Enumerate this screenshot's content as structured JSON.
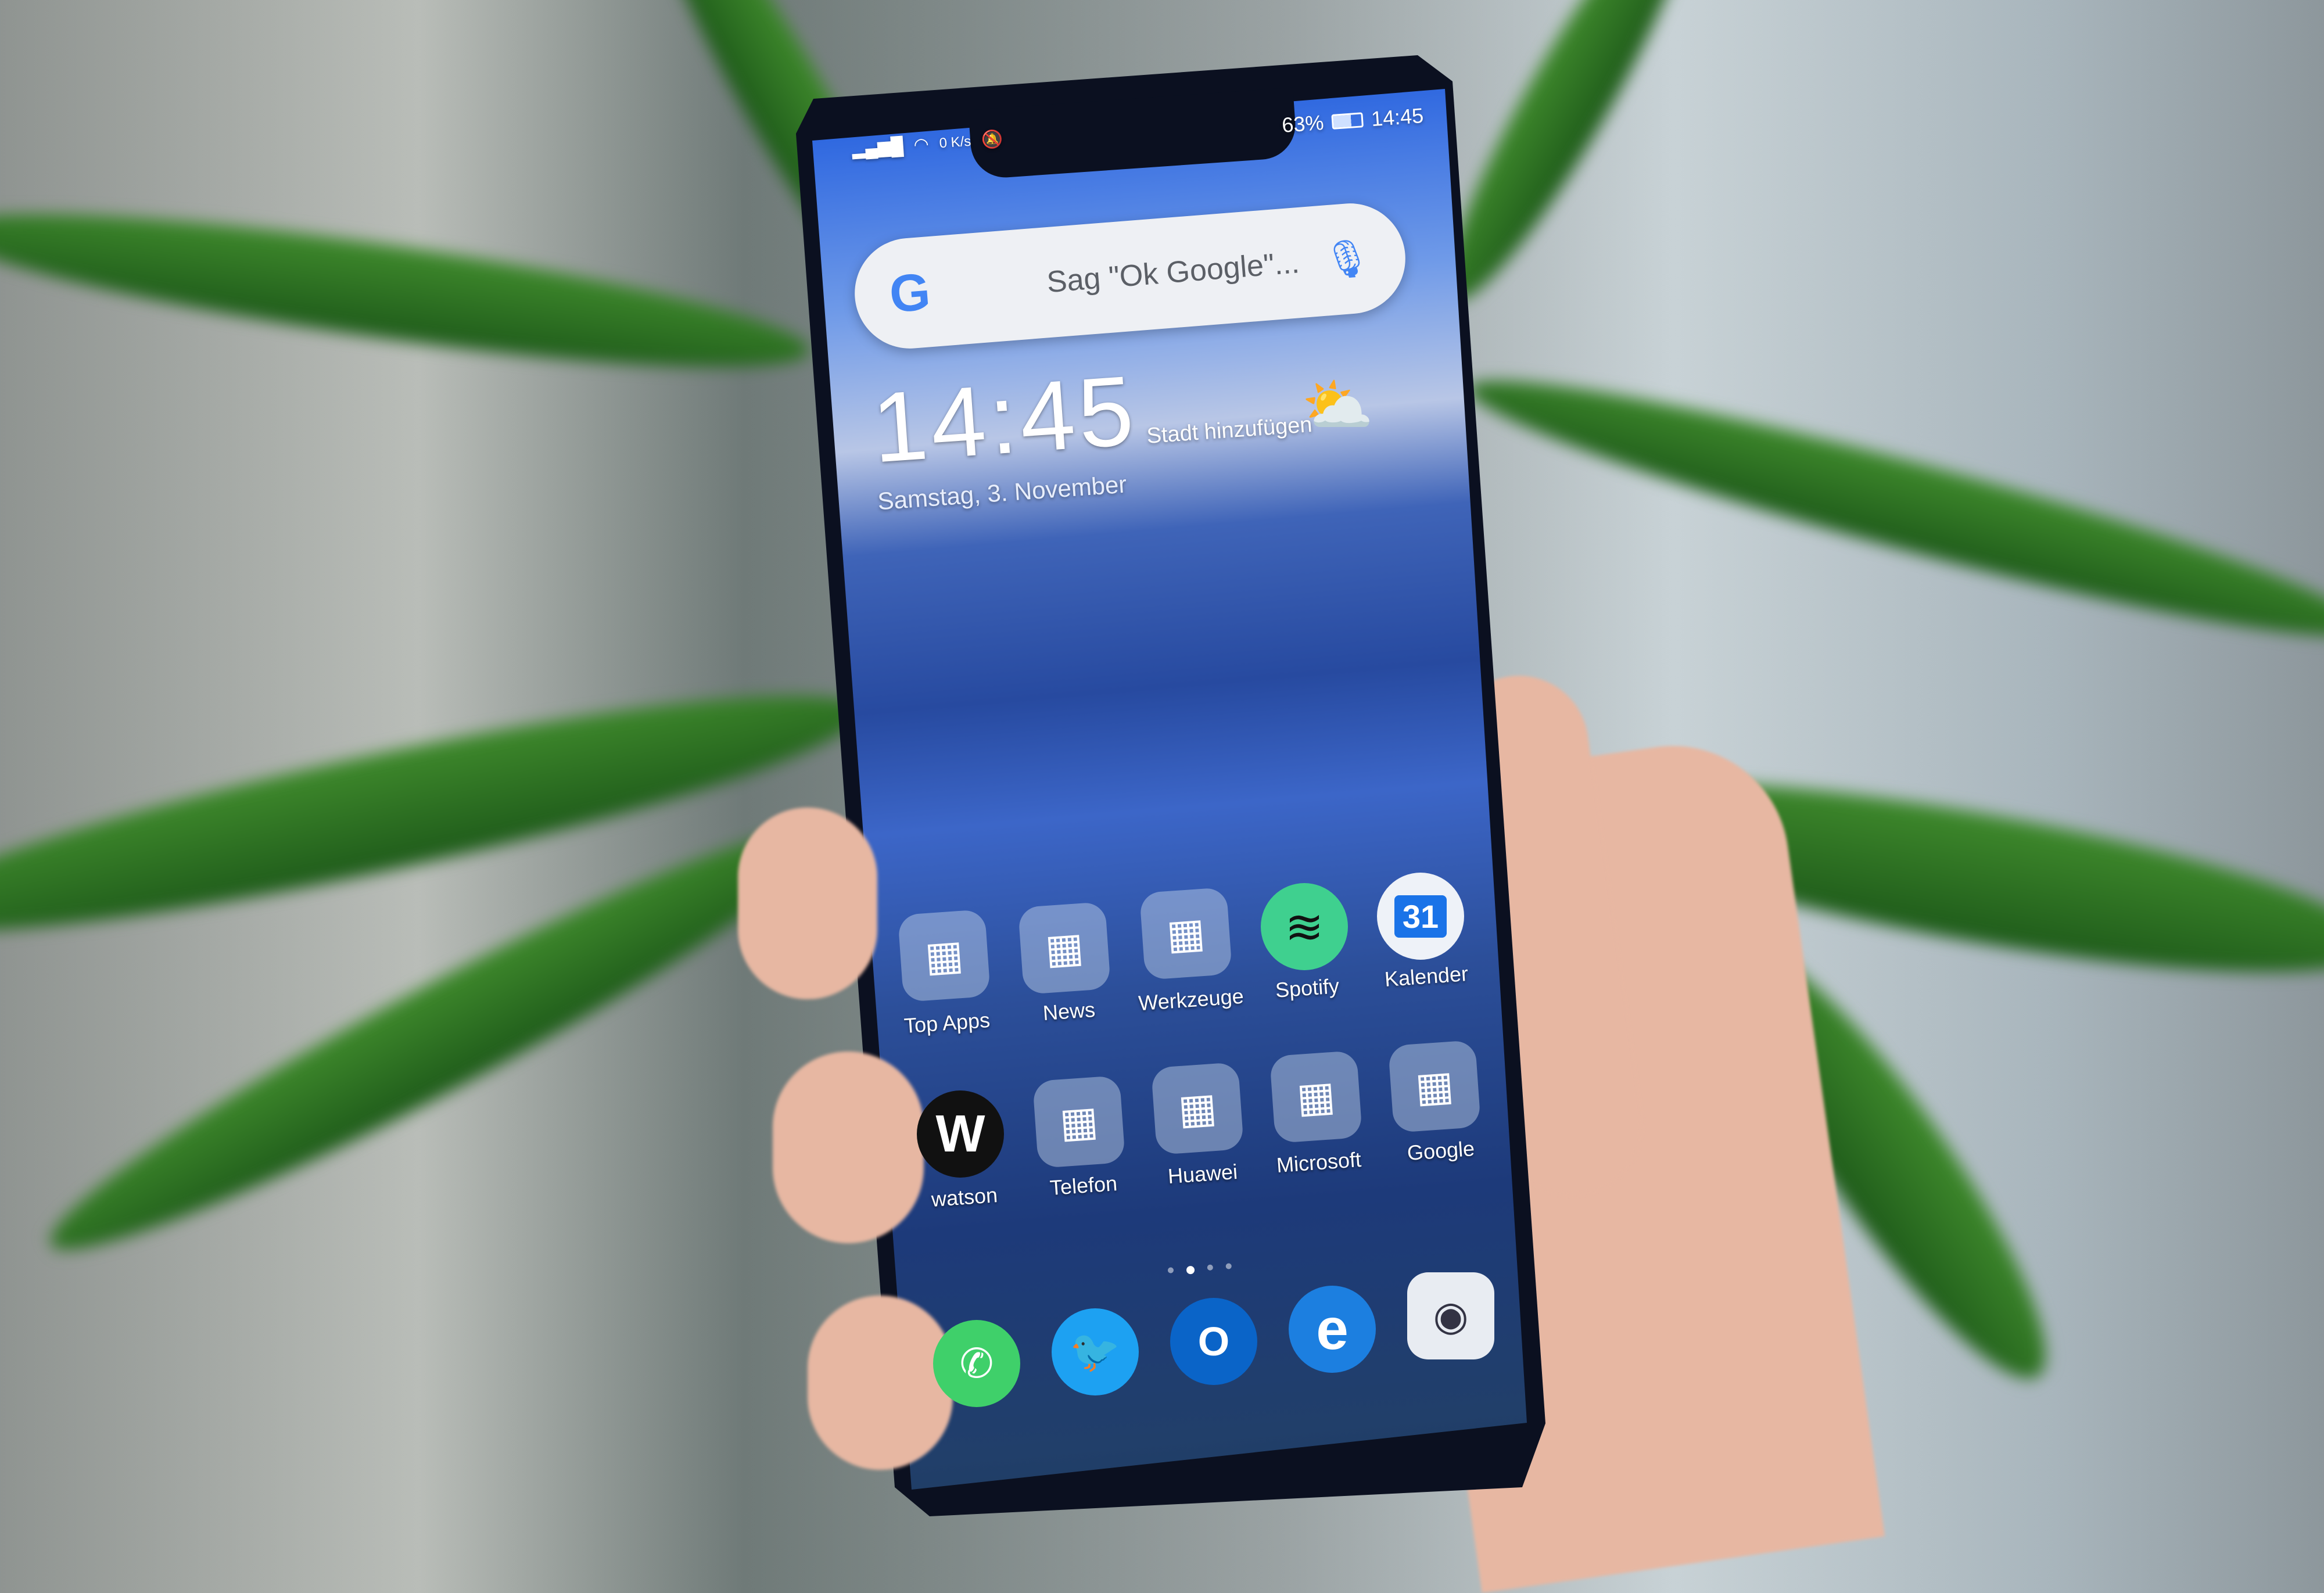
{
  "status_bar": {
    "network_speed": "0 K/s",
    "battery": "63%",
    "time": "14:45",
    "icons": [
      "signal-icon",
      "wifi-icon",
      "bell-off-icon",
      "battery-icon"
    ]
  },
  "search": {
    "placeholder": "Sag \"Ok Google\"...",
    "logo": "G",
    "icons": [
      "google-logo-icon",
      "microphone-icon"
    ]
  },
  "clock": {
    "time": "14:45",
    "city": "Stadt hinzufügen",
    "date": "Samstag, 3. November",
    "weather_icon": "partly-cloudy-icon"
  },
  "apps_row1": [
    {
      "label": "Top Apps",
      "type": "folder"
    },
    {
      "label": "News",
      "type": "folder"
    },
    {
      "label": "Werkzeuge",
      "type": "folder"
    },
    {
      "label": "Spotify",
      "type": "app"
    },
    {
      "label": "Kalender",
      "type": "app",
      "glyph": "31"
    }
  ],
  "apps_row2": [
    {
      "label": "watson",
      "type": "app",
      "glyph": "W"
    },
    {
      "label": "Telefon",
      "type": "folder"
    },
    {
      "label": "Huawei",
      "type": "folder"
    },
    {
      "label": "Microsoft",
      "type": "folder"
    },
    {
      "label": "Google",
      "type": "folder"
    }
  ],
  "dock": [
    {
      "name": "whatsapp-icon"
    },
    {
      "name": "twitter-icon"
    },
    {
      "name": "outlook-icon",
      "glyph": "O"
    },
    {
      "name": "edge-icon",
      "glyph": "e"
    },
    {
      "name": "camera-icon"
    }
  ],
  "colors": {
    "spotify": "#3fd08f",
    "calendar": "#1a73e8",
    "whatsapp": "#3fd06a",
    "twitter": "#1da1f2",
    "outlook": "#0a64c8",
    "edge": "#1c7fe0"
  }
}
